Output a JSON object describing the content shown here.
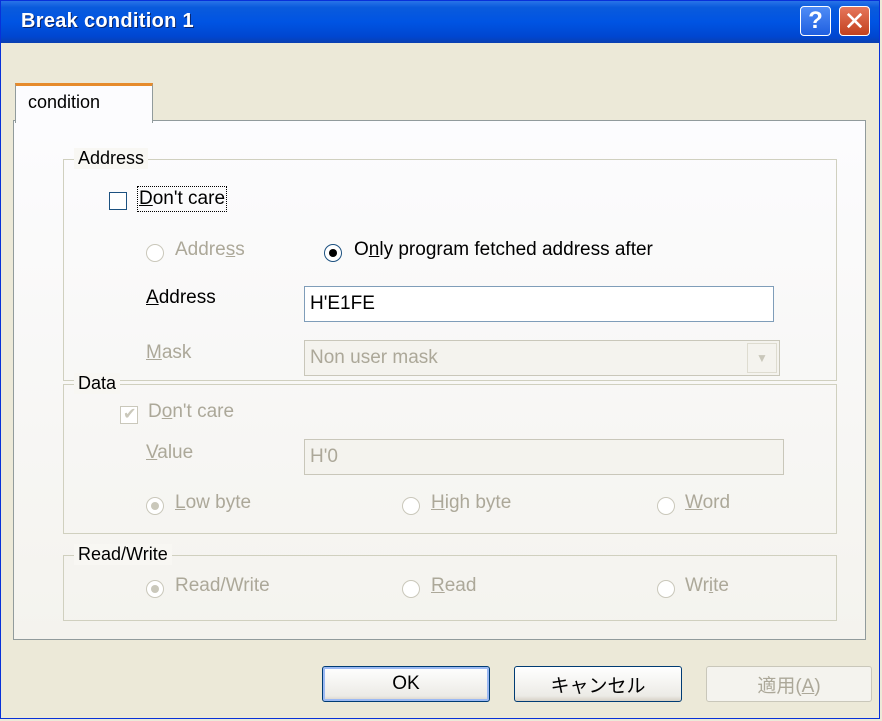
{
  "window": {
    "title": "Break condition 1",
    "help_icon": "?",
    "close_icon": "✕"
  },
  "tabs": [
    {
      "label": "condition"
    }
  ],
  "address_group": {
    "legend": "Address",
    "dont_care": {
      "pre": "",
      "ul": "D",
      "post": "on't care",
      "checked": false
    },
    "radio_address": {
      "pre": "Address",
      "ul": "",
      "post": "s",
      "selected": false,
      "enabled": false
    },
    "radio_address_pre": "Addre",
    "radio_address_ul": "s",
    "radio_address_post": "s",
    "radio_only": {
      "pre": "O",
      "ul": "n",
      "post": "ly program fetched address after",
      "selected": true
    },
    "address_label": {
      "ul": "A",
      "post": "ddress"
    },
    "address_value": "H'E1FE",
    "mask_label": {
      "ul": "M",
      "post": "ask"
    },
    "mask_value": "Non user mask"
  },
  "data_group": {
    "legend": "Data",
    "dont_care": {
      "pre": "D",
      "ul": "o",
      "post": "n't care",
      "checked": true
    },
    "value_label": {
      "ul": "V",
      "post": "alue"
    },
    "value_value": "H'0",
    "low_byte": {
      "ul": "L",
      "post": "ow byte",
      "selected": true
    },
    "high_byte": {
      "ul": "H",
      "post": "igh byte",
      "selected": false
    },
    "word": {
      "ul": "W",
      "post": "ord",
      "selected": false
    }
  },
  "rw_group": {
    "legend": "Read/Write",
    "read_write": {
      "label": "Read/Write",
      "selected": true
    },
    "read": {
      "ul": "R",
      "post": "ead",
      "selected": false
    },
    "write": {
      "pre": "Wr",
      "ul": "i",
      "post": "te",
      "selected": false
    }
  },
  "buttons": {
    "ok": "OK",
    "cancel": "キャンセル",
    "apply_pre": "適用(",
    "apply_ul": "A",
    "apply_post": ")"
  },
  "colors": {
    "titlebar": "#0054e3",
    "dialog_bg": "#ece9d8",
    "tab_accent": "#e68b2c",
    "disabled_text": "#aca899",
    "radio_selected": "#21a121"
  }
}
